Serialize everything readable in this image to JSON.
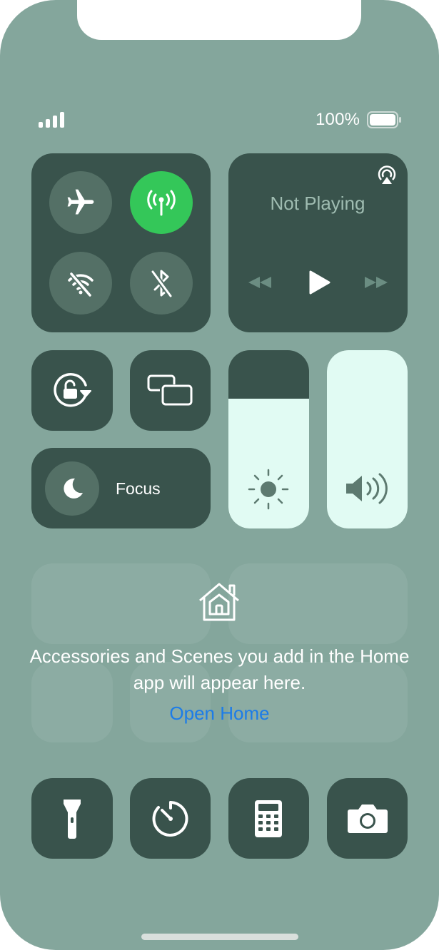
{
  "status_bar": {
    "battery_percent": "100%",
    "signal_icon": "cellular-signal-icon",
    "battery_icon": "battery-full-icon"
  },
  "connectivity": {
    "airplane": {
      "icon": "airplane-icon",
      "active": false
    },
    "cellular": {
      "icon": "cellular-antenna-icon",
      "active": true
    },
    "wifi": {
      "icon": "wifi-off-icon",
      "active": false
    },
    "bluetooth": {
      "icon": "bluetooth-off-icon",
      "active": false
    }
  },
  "now_playing": {
    "title": "Not Playing",
    "airplay_icon": "airplay-icon",
    "controls": [
      "rewind-icon",
      "play-icon",
      "fast-forward-icon"
    ]
  },
  "controls": {
    "orientation_lock_icon": "orientation-lock-icon",
    "screen_mirroring_icon": "screen-mirroring-icon",
    "focus_label": "Focus",
    "focus_icon": "moon-icon"
  },
  "sliders": {
    "brightness": {
      "icon": "sun-icon",
      "level": 0.73
    },
    "volume": {
      "icon": "speaker-icon",
      "level": 1.0
    }
  },
  "home": {
    "icon": "home-icon",
    "message": "Accessories and Scenes you add in the Home app will appear here.",
    "link": "Open Home"
  },
  "shortcuts": [
    "flashlight-icon",
    "timer-icon",
    "calculator-icon",
    "camera-icon"
  ],
  "colors": {
    "background": "#84a69c",
    "tile": "#39534c",
    "circle": "#547066",
    "active_green": "#34c759",
    "slider_fill": "#e1fbf3",
    "link_blue": "#1c7ce8"
  }
}
